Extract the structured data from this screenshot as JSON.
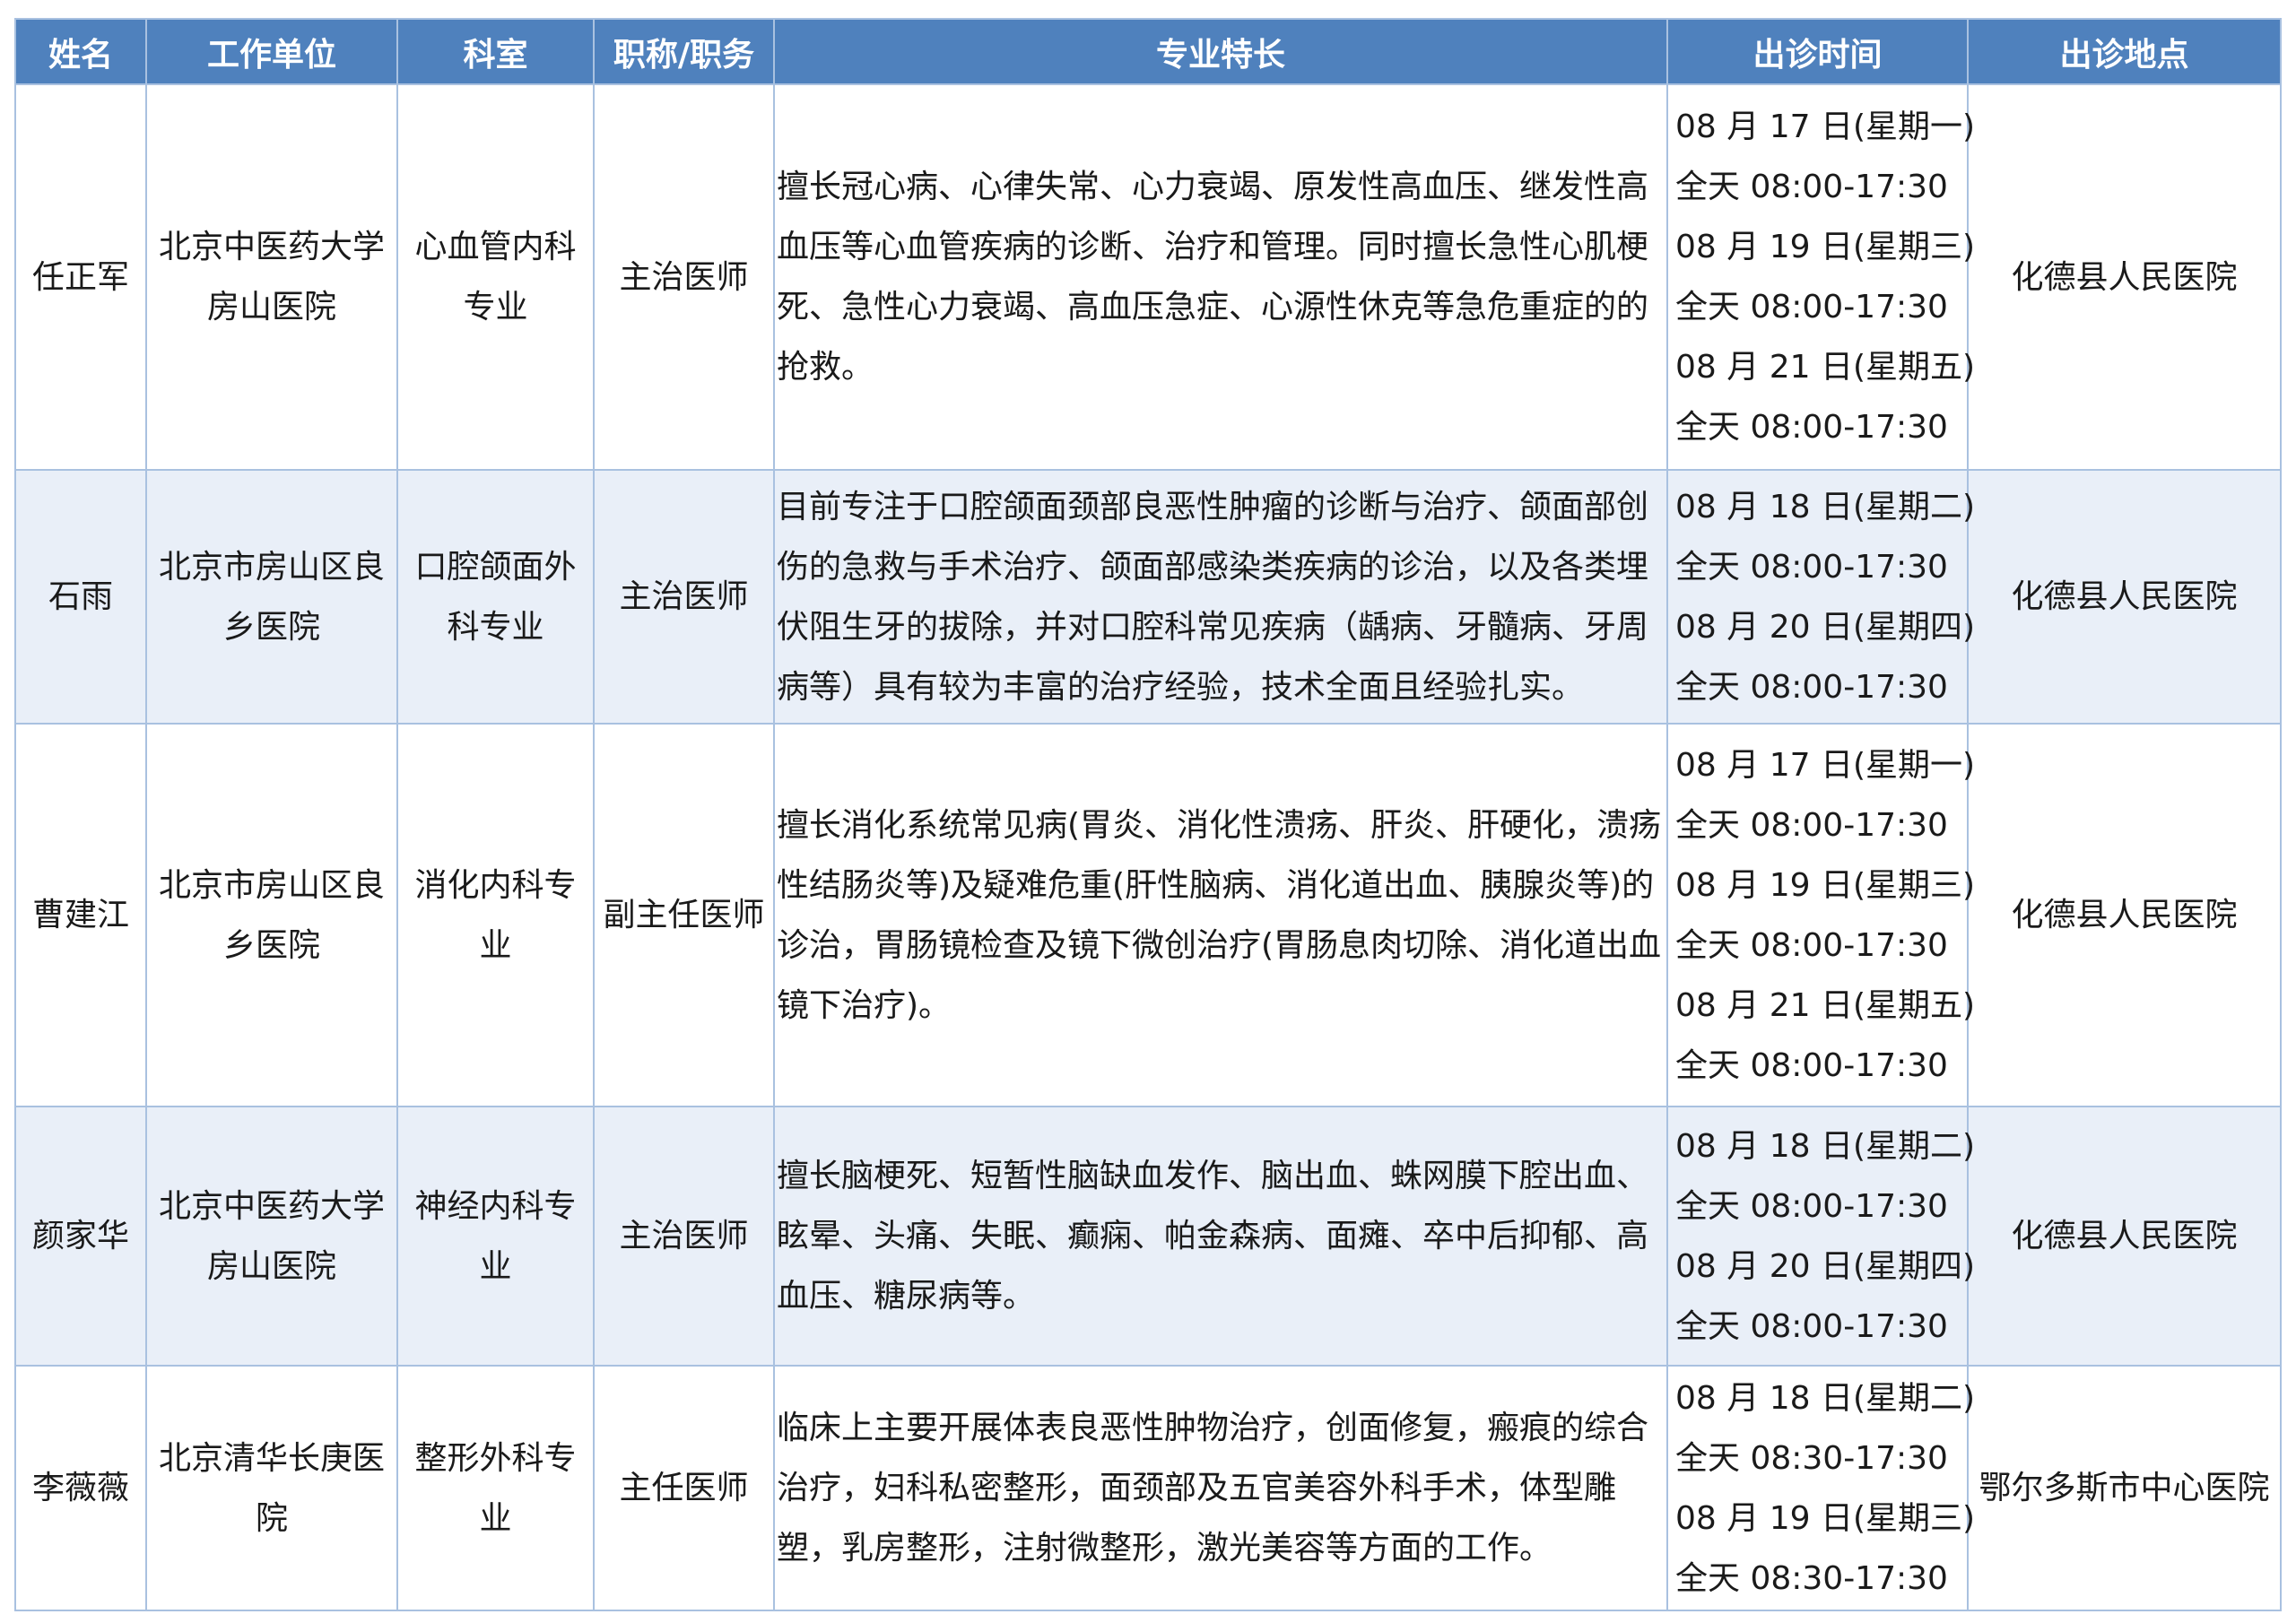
{
  "headers": [
    "姓名",
    "工作单位",
    "科室",
    "职称/职务",
    "专业特长",
    "出诊时间",
    "出诊地点"
  ],
  "doctors": [
    {
      "name": "任正军",
      "unit": "北京中医药大学房山医院",
      "dept": "心血管内科专业",
      "title": "主治医师",
      "specialty": "擅长冠心病、心律失常、心力衰竭、原发性高血压、继发性高血压等心血管疾病的诊断、治疗和管理。同时擅长急性心肌梗死、急性心力衰竭、高血压急症、心源性休克等急危重症的的抢救。",
      "schedule": [
        "08 月 17 日(星期一)",
        "全天 08:00-17:30",
        "08 月 19 日(星期三)",
        "全天 08:00-17:30",
        "08 月 21 日(星期五)",
        "全天 08:00-17:30"
      ],
      "place": "化德县人民医院"
    },
    {
      "name": "石雨",
      "unit": "北京市房山区良乡医院",
      "dept": "口腔颌面外科专业",
      "title": "主治医师",
      "specialty": "目前专注于口腔颌面颈部良恶性肿瘤的诊断与治疗、颌面部创伤的急救与手术治疗、颌面部感染类疾病的诊治，以及各类埋伏阻生牙的拔除，并对口腔科常见疾病（龋病、牙髓病、牙周病等）具有较为丰富的治疗经验，技术全面且经验扎实。",
      "schedule": [
        "08 月 18 日(星期二)",
        "全天 08:00-17:30",
        "08 月 20 日(星期四)",
        "全天 08:00-17:30"
      ],
      "place": "化德县人民医院"
    },
    {
      "name": "曹建江",
      "unit": "北京市房山区良乡医院",
      "dept": "消化内科专业",
      "title": "副主任医师",
      "specialty": "擅长消化系统常见病(胃炎、消化性溃疡、肝炎、肝硬化，溃疡性结肠炎等)及疑难危重(肝性脑病、消化道出血、胰腺炎等)的诊治，胃肠镜检查及镜下微创治疗(胃肠息肉切除、消化道出血镜下治疗)。",
      "schedule": [
        "08 月 17 日(星期一)",
        "全天 08:00-17:30",
        "08 月 19 日(星期三)",
        "全天 08:00-17:30",
        "08 月 21 日(星期五)",
        "全天 08:00-17:30"
      ],
      "place": "化德县人民医院"
    },
    {
      "name": "颜家华",
      "unit": "北京中医药大学房山医院",
      "dept": "神经内科专业",
      "title": "主治医师",
      "specialty": "擅长脑梗死、短暂性脑缺血发作、脑出血、蛛网膜下腔出血、眩晕、头痛、失眠、癫痫、帕金森病、面瘫、卒中后抑郁、高血压、糖尿病等。",
      "schedule": [
        "08 月 18 日(星期二)",
        "全天 08:00-17:30",
        "08 月 20 日(星期四)",
        "全天 08:00-17:30"
      ],
      "place": "化德县人民医院"
    },
    {
      "name": "李薇薇",
      "unit": "北京清华长庚医院",
      "dept": "整形外科专业",
      "title": "主任医师",
      "specialty": "临床上主要开展体表良恶性肿物治疗，创面修复，瘢痕的综合治疗，妇科私密整形，面颈部及五官美容外科手术，体型雕塑，乳房整形，注射微整形，激光美容等方面的工作。",
      "schedule": [
        "08 月 18 日(星期二)",
        "全天 08:30-17:30",
        "08 月 19 日(星期三)",
        "全天 08:30-17:30"
      ],
      "place": "鄂尔多斯市中心医院"
    }
  ],
  "colors": {
    "header_bg": "#4f81bd",
    "header_text": "#ffffff",
    "alt_row_bg": "#e9eff8",
    "grid_line": "#a9c1e0"
  }
}
